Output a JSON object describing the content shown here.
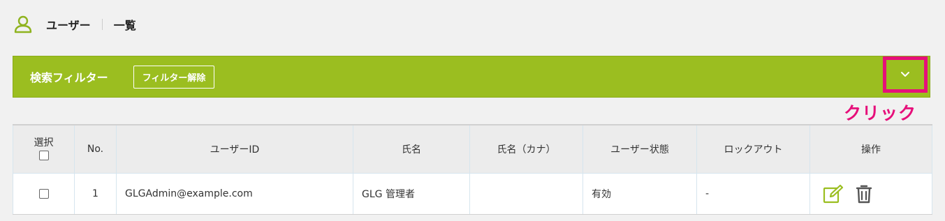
{
  "header": {
    "title": "ユーザー",
    "subtitle": "一覧",
    "icon": "user-icon"
  },
  "filter": {
    "title": "検索フィルター",
    "clear_label": "フィルター解除",
    "toggle_icon": "chevron-down-icon"
  },
  "annotation": {
    "click_label": "クリック",
    "color": "#e60f7a"
  },
  "table": {
    "headers": {
      "select": "選択",
      "no": "No.",
      "user_id": "ユーザーID",
      "name": "氏名",
      "name_kana": "氏名（カナ）",
      "status": "ユーザー状態",
      "lockout": "ロックアウト",
      "ops": "操作"
    },
    "rows": [
      {
        "no": "1",
        "user_id": "GLGAdmin@example.com",
        "name": "GLG 管理者",
        "name_kana": "",
        "status": "有効",
        "lockout": "-"
      }
    ]
  },
  "colors": {
    "accent": "#9bbe20",
    "highlight": "#e60f7a"
  }
}
